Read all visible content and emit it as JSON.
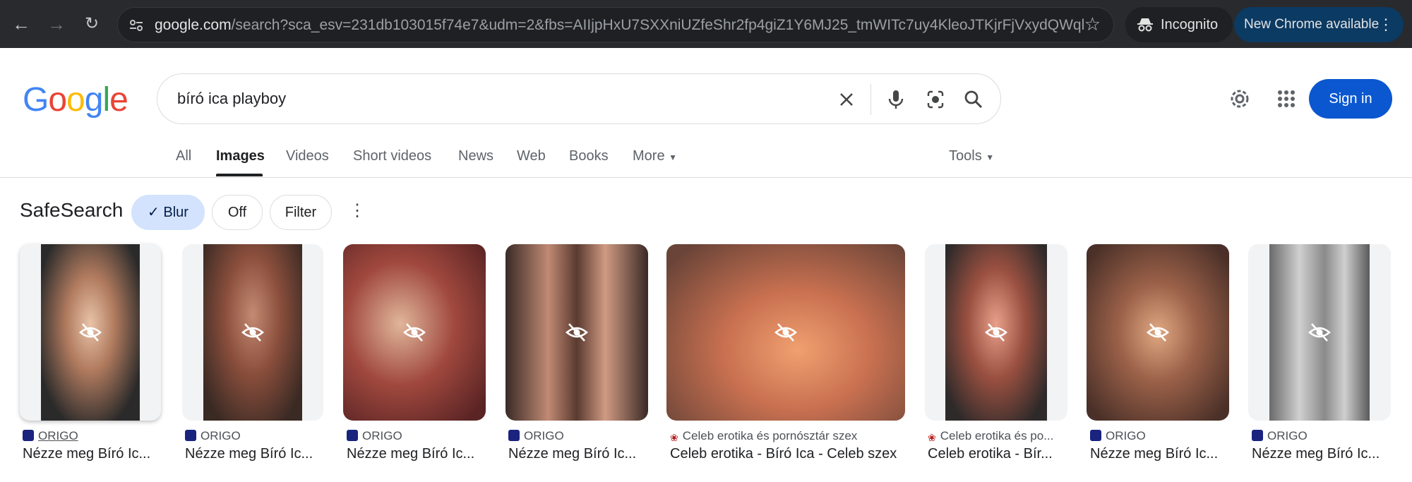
{
  "browser": {
    "url_host": "google.com",
    "url_rest": "/search?sca_esv=231db103015f74e7&udm=2&fbs=AIIjpHxU7SXXniUZfeShr2fp4giZ1Y6MJ25_tmWITc7uy4KleoJTKjrFjVxydQWql...",
    "incognito_label": "Incognito",
    "update_label": "New Chrome available"
  },
  "logo": {
    "G": "G",
    "o1": "o",
    "o2": "o",
    "g": "g",
    "l": "l",
    "e": "e"
  },
  "search": {
    "query": "bíró ica playboy"
  },
  "header": {
    "sign_in": "Sign in"
  },
  "tabs": [
    {
      "label": "All"
    },
    {
      "label": "Images"
    },
    {
      "label": "Videos"
    },
    {
      "label": "Short videos"
    },
    {
      "label": "News"
    },
    {
      "label": "Web"
    },
    {
      "label": "Books"
    },
    {
      "label": "More"
    }
  ],
  "tools_label": "Tools",
  "safesearch": {
    "label": "SafeSearch",
    "blur": "Blur",
    "off": "Off",
    "filter": "Filter"
  },
  "results": [
    {
      "source": "ORIGO",
      "title": "Nézze meg Bíró Ic..."
    },
    {
      "source": "ORIGO",
      "title": "Nézze meg Bíró Ic..."
    },
    {
      "source": "ORIGO",
      "title": "Nézze meg Bíró Ic..."
    },
    {
      "source": "ORIGO",
      "title": "Nézze meg Bíró Ic..."
    },
    {
      "source": "Celeb erotika és pornósztár szex",
      "title": "Celeb erotika - Bíró Ica - Celeb szex"
    },
    {
      "source": "Celeb erotika és po...",
      "title": "Celeb erotika - Bír..."
    },
    {
      "source": "ORIGO",
      "title": "Nézze meg Bíró Ic..."
    },
    {
      "source": "ORIGO",
      "title": "Nézze meg Bíró Ic..."
    }
  ],
  "colors": {
    "brand_blue": "#0b57d0",
    "chip_selected": "#d3e3fd",
    "chrome_bg": "#282a2e"
  }
}
